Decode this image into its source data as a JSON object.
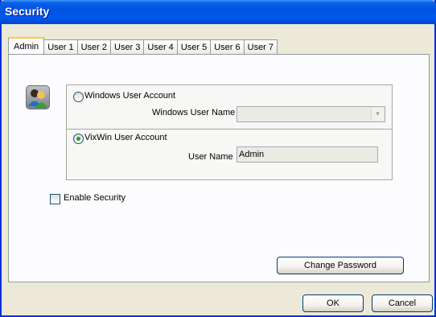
{
  "window": {
    "title": "Security"
  },
  "tabs": [
    {
      "label": "Admin",
      "active": true
    },
    {
      "label": "User 1"
    },
    {
      "label": "User 2"
    },
    {
      "label": "User 3"
    },
    {
      "label": "User 4"
    },
    {
      "label": "User 5"
    },
    {
      "label": "User 6"
    },
    {
      "label": "User 7"
    }
  ],
  "account": {
    "windows_option_label": "Windows User Account",
    "windows_user_name_label": "Windows User Name",
    "windows_user_name_value": "",
    "vixwin_option_label": "VixWin User Account",
    "vixwin_selected": true,
    "user_name_label": "User Name",
    "user_name_value": "Admin"
  },
  "security": {
    "enable_label": "Enable Security",
    "enabled": false
  },
  "buttons": {
    "change_password": "Change Password",
    "ok": "OK",
    "cancel": "Cancel"
  },
  "icons": {
    "users": "users-icon",
    "dropdown": "chevron-down-icon"
  },
  "colors": {
    "titlebar": "#0054e3",
    "dialog_bg": "#ece9d8",
    "active_tab_accent": "#ffc83c"
  }
}
